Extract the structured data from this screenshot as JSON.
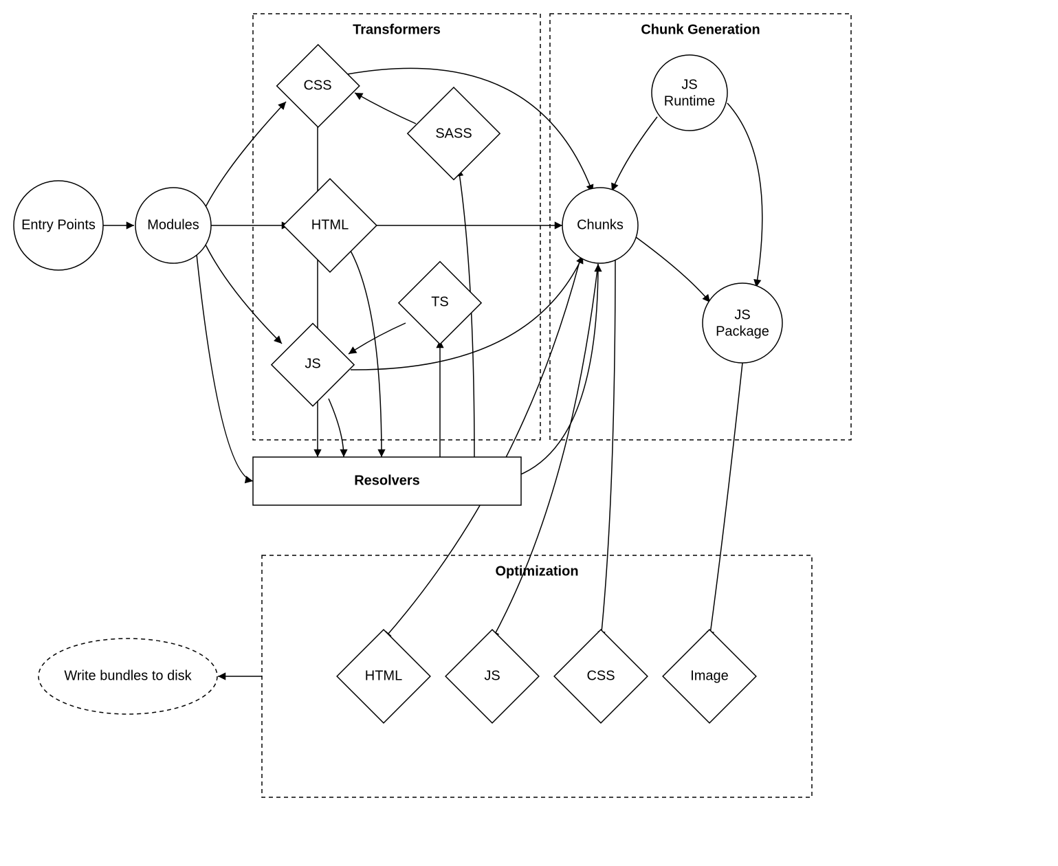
{
  "groups": {
    "transformers": {
      "title": "Transformers"
    },
    "chunk_generation": {
      "title": "Chunk Generation"
    },
    "optimization": {
      "title": "Optimization"
    }
  },
  "nodes": {
    "entry_points": {
      "label": "Entry Points",
      "shape": "circle"
    },
    "modules": {
      "label": "Modules",
      "shape": "circle"
    },
    "css": {
      "label": "CSS",
      "shape": "diamond",
      "group": "transformers"
    },
    "sass": {
      "label": "SASS",
      "shape": "diamond",
      "group": "transformers"
    },
    "html": {
      "label": "HTML",
      "shape": "diamond",
      "group": "transformers"
    },
    "ts": {
      "label": "TS",
      "shape": "diamond",
      "group": "transformers"
    },
    "js": {
      "label": "JS",
      "shape": "diamond",
      "group": "transformers"
    },
    "resolvers": {
      "label": "Resolvers",
      "shape": "rect"
    },
    "chunks": {
      "label": "Chunks",
      "shape": "circle",
      "group": "chunk_generation"
    },
    "js_runtime": {
      "label_lines": [
        "JS",
        "Runtime"
      ],
      "shape": "circle",
      "group": "chunk_generation"
    },
    "js_package": {
      "label_lines": [
        "JS",
        "Package"
      ],
      "shape": "circle",
      "group": "chunk_generation"
    },
    "opt_html": {
      "label": "HTML",
      "shape": "diamond",
      "group": "optimization"
    },
    "opt_js": {
      "label": "JS",
      "shape": "diamond",
      "group": "optimization"
    },
    "opt_css": {
      "label": "CSS",
      "shape": "diamond",
      "group": "optimization"
    },
    "opt_image": {
      "label": "Image",
      "shape": "diamond",
      "group": "optimization"
    },
    "write_bundles": {
      "label": "Write bundles to disk",
      "shape": "dashed-ellipse"
    }
  },
  "edges": [
    {
      "from": "entry_points",
      "to": "modules"
    },
    {
      "from": "modules",
      "to": "css"
    },
    {
      "from": "modules",
      "to": "html"
    },
    {
      "from": "modules",
      "to": "js"
    },
    {
      "from": "modules",
      "to": "resolvers"
    },
    {
      "from": "sass",
      "to": "css"
    },
    {
      "from": "ts",
      "to": "js"
    },
    {
      "from": "css",
      "to": "resolvers"
    },
    {
      "from": "html",
      "to": "resolvers"
    },
    {
      "from": "js",
      "to": "resolvers"
    },
    {
      "from": "resolvers",
      "to": "sass"
    },
    {
      "from": "resolvers",
      "to": "ts"
    },
    {
      "from": "css",
      "to": "chunks"
    },
    {
      "from": "html",
      "to": "chunks"
    },
    {
      "from": "js",
      "to": "chunks"
    },
    {
      "from": "resolvers",
      "to": "chunks"
    },
    {
      "from": "js_runtime",
      "to": "chunks"
    },
    {
      "from": "js_runtime",
      "to": "js_package"
    },
    {
      "from": "chunks",
      "to": "js_package"
    },
    {
      "from": "chunks",
      "to": "opt_html"
    },
    {
      "from": "chunks",
      "to": "opt_js"
    },
    {
      "from": "chunks",
      "to": "opt_css"
    },
    {
      "from": "js_package",
      "to": "opt_image"
    },
    {
      "from": "optimization",
      "to": "write_bundles"
    }
  ]
}
